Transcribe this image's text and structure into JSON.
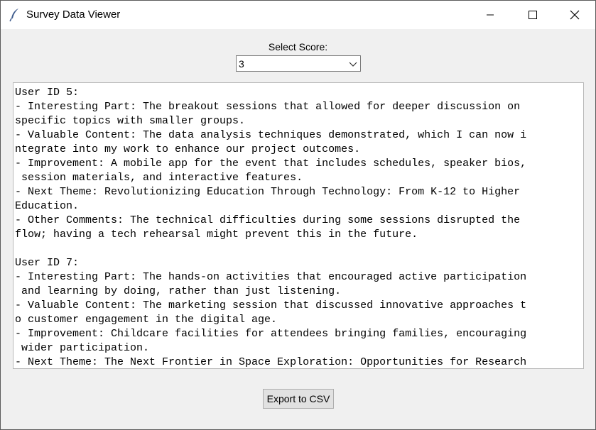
{
  "window": {
    "title": "Survey Data Viewer"
  },
  "score_selector": {
    "label": "Select Score:",
    "selected_value": "3"
  },
  "text_area": {
    "lines": [
      "User ID 5:",
      "- Interesting Part: The breakout sessions that allowed for deeper discussion on",
      "specific topics with smaller groups.",
      "- Valuable Content: The data analysis techniques demonstrated, which I can now i",
      "ntegrate into my work to enhance our project outcomes.",
      "- Improvement: A mobile app for the event that includes schedules, speaker bios,",
      " session materials, and interactive features.",
      "- Next Theme: Revolutionizing Education Through Technology: From K-12 to Higher",
      "Education.",
      "- Other Comments: The technical difficulties during some sessions disrupted the",
      "flow; having a tech rehearsal might prevent this in the future.",
      "",
      "User ID 7:",
      "- Interesting Part: The hands-on activities that encouraged active participation",
      " and learning by doing, rather than just listening.",
      "- Valuable Content: The marketing session that discussed innovative approaches t",
      "o customer engagement in the digital age.",
      "- Improvement: Childcare facilities for attendees bringing families, encouraging",
      " wider participation.",
      "- Next Theme: The Next Frontier in Space Exploration: Opportunities for Research"
    ]
  },
  "export_button": {
    "label": "Export to CSV"
  }
}
